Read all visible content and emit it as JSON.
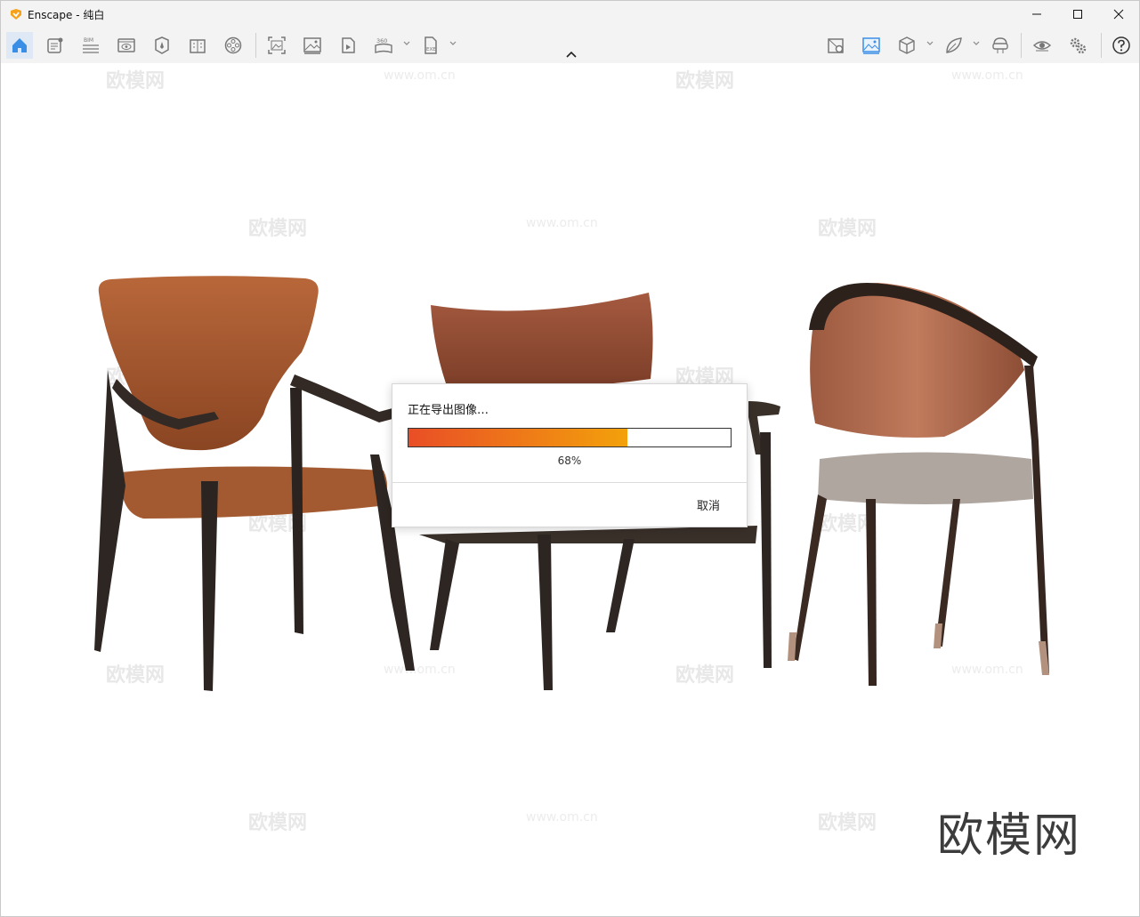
{
  "window": {
    "title": "Enscape - 纯白"
  },
  "dialog": {
    "title": "正在导出图像…",
    "progress_fraction": 0.68,
    "progress_label": "68%",
    "cancel_label": "取消"
  },
  "watermark": {
    "text": "欧模网",
    "url_text": "www.om.cn",
    "brand_logo": "欧模网"
  },
  "toolbar": {
    "left_icons": [
      "home-icon",
      "notes-icon",
      "bim-icon",
      "view-management-icon",
      "asset-library-icon",
      "materials-icon",
      "video-editor-icon",
      "screenshot-icon",
      "render-image-icon",
      "batch-render-icon",
      "panorama-360-icon",
      "export-exe-icon"
    ],
    "right_icons": [
      "map-icon",
      "visual-settings-icon",
      "cube-view-icon",
      "leaf-icon",
      "vr-headset-icon",
      "eye-icon",
      "settings-gears-icon",
      "help-icon"
    ],
    "bim_label": "BIM",
    "pano_label": "360",
    "exe_label": "EXE"
  },
  "colors": {
    "accent": "#3a8ee6",
    "progress_start": "#e94e26",
    "progress_end": "#f3a10b"
  }
}
